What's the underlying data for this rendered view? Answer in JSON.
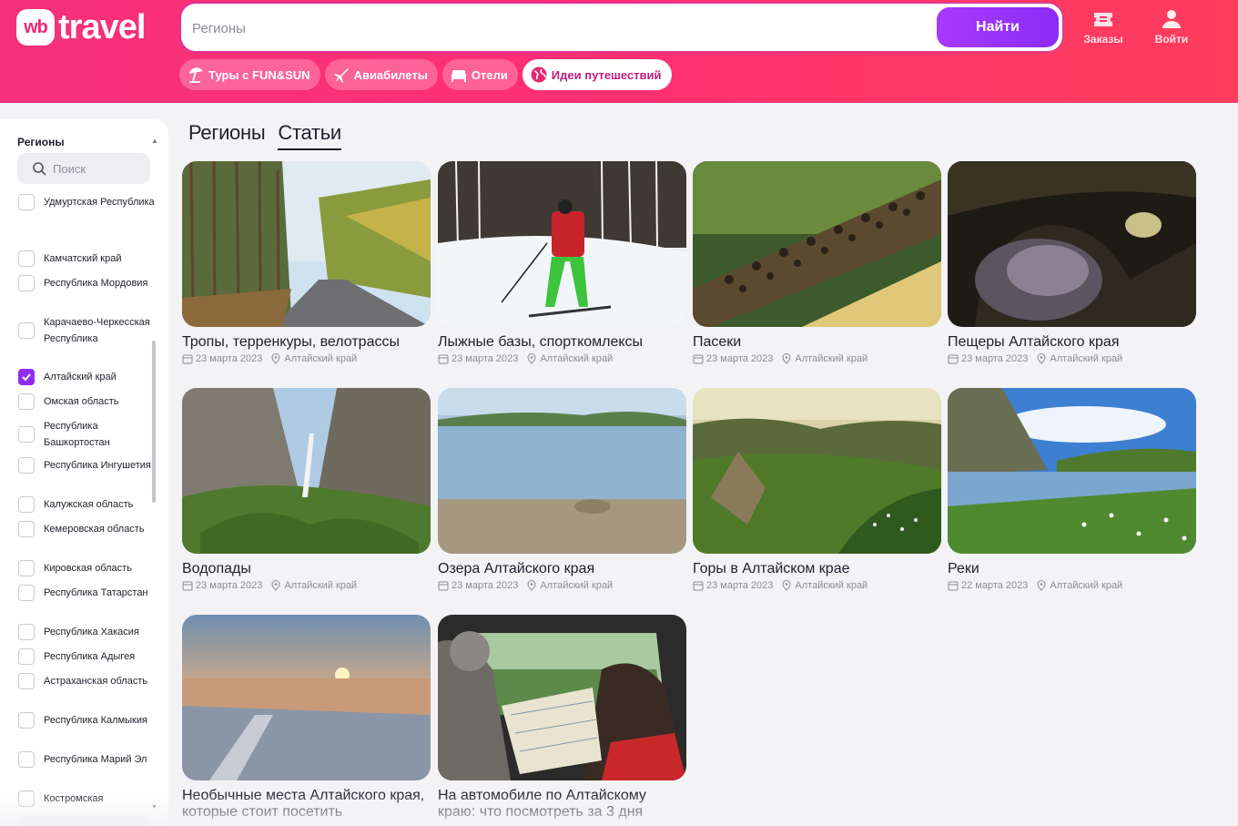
{
  "colors": {
    "accent": "#8e2cf5",
    "header_start": "#f5307a",
    "header_end": "#ff3d5c",
    "chip_active_text": "#c01e7f"
  },
  "header": {
    "logo_badge": "wb",
    "logo_text": "travel",
    "search_placeholder": "Регионы",
    "search_button": "Найти",
    "orders_label": "Заказы",
    "orders_icon": "ticket-icon",
    "login_label": "Войти",
    "login_icon": "user-icon",
    "chips": [
      {
        "label": "Туры с FUN&SUN",
        "icon": "beach-umbrella-icon",
        "active": false
      },
      {
        "label": "Авиабилеты",
        "icon": "airplane-icon",
        "active": false
      },
      {
        "label": "Отели",
        "icon": "bed-icon",
        "active": false
      },
      {
        "label": "Идеи путешествий",
        "icon": "globe-icon",
        "active": true
      }
    ]
  },
  "sidebar": {
    "title": "Регионы",
    "search_placeholder": "Поиск",
    "items": [
      {
        "label": "Удмуртская Республика",
        "checked": false
      },
      {
        "label": "Камчатский край",
        "checked": false
      },
      {
        "label": "Республика Мордовия",
        "checked": false
      },
      {
        "label": "Карачаево-Черкесская Республика",
        "checked": false
      },
      {
        "label": "Алтайский край",
        "checked": true
      },
      {
        "label": "Омская область",
        "checked": false
      },
      {
        "label": "Республика Башкортостан",
        "checked": false
      },
      {
        "label": "Республика Ингушетия",
        "checked": false
      },
      {
        "label": "Калужская область",
        "checked": false
      },
      {
        "label": "Кемеровская область",
        "checked": false
      },
      {
        "label": "Кировская область",
        "checked": false
      },
      {
        "label": "Республика Татарстан",
        "checked": false
      },
      {
        "label": "Республика Хакасия",
        "checked": false
      },
      {
        "label": "Республика Адыгея",
        "checked": false
      },
      {
        "label": "Астраханская область",
        "checked": false
      },
      {
        "label": "Республика Калмыкия",
        "checked": false
      },
      {
        "label": "Республика Марий Эл",
        "checked": false
      },
      {
        "label": "Костромская",
        "checked": false
      }
    ]
  },
  "main": {
    "tabs": [
      {
        "label": "Регионы",
        "active": false
      },
      {
        "label": "Статьи",
        "active": true
      }
    ],
    "articles": [
      {
        "title": "Тропы, терренкуры, велотрассы",
        "date": "23 марта 2023",
        "location": "Алтайский край",
        "image": "forest-road"
      },
      {
        "title": "Лыжные базы, спорткомлексы",
        "date": "23 марта 2023",
        "location": "Алтайский край",
        "image": "skier"
      },
      {
        "title": "Пасеки",
        "date": "23 марта 2023",
        "location": "Алтайский край",
        "image": "bees"
      },
      {
        "title": "Пещеры Алтайского края",
        "date": "23 марта 2023",
        "location": "Алтайский край",
        "image": "cave"
      },
      {
        "title": "Водопады",
        "date": "23 марта 2023",
        "location": "Алтайский край",
        "image": "waterfall"
      },
      {
        "title": "Озера Алтайского края",
        "date": "23 марта 2023",
        "location": "Алтайский край",
        "image": "lake"
      },
      {
        "title": "Горы в Алтайском крае",
        "date": "23 марта 2023",
        "location": "Алтайский край",
        "image": "mountains"
      },
      {
        "title": "Реки",
        "date": "22 марта 2023",
        "location": "Алтайский край",
        "image": "river"
      },
      {
        "title": "Необычные места Алтайского края, которые стоит посетить",
        "date": "",
        "location": "",
        "image": "sunset-lake"
      },
      {
        "title": "На автомобиле по Алтайскому краю: что посмотреть за 3 дня",
        "date": "",
        "location": "",
        "image": "car-map"
      }
    ]
  }
}
